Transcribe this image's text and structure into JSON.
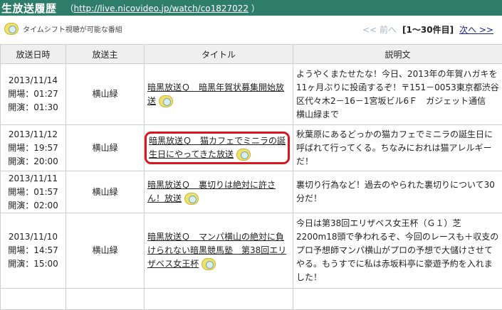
{
  "header": {
    "title": "生放送履歴",
    "open_paren": "（",
    "url": "http://live.nicovideo.jp/watch/co1827022",
    "close_paren": "）"
  },
  "toolbar": {
    "legend_icon": "timeshift-icon",
    "legend_text": "タイムシフト視聴が可能な番組",
    "prev_label": "<< 前へ",
    "range_label": "[1～30件目]",
    "next_label": "次へ >>"
  },
  "table": {
    "headers": [
      "放送日時",
      "放送主",
      "タイトル",
      "説明文"
    ],
    "rows": [
      {
        "date": "2013/11/14",
        "open": "開場：01:27",
        "start": "開演：01:30",
        "owner": "横山緑",
        "title": "暗黒放送Ｑ　暗黒年賀状募集開始放送",
        "desc": "ようやくまたせたな！今日、2013年の年賀ハガキを11ヶ月ぶりに投函するぞ！〒151－0053東京都渋谷区代々木2－16－1宮坂ビル6Ｆ　ガジェット通信　横山緑まで"
      },
      {
        "date": "2013/11/12",
        "open": "開場：19:57",
        "start": "開演：20:00",
        "owner": "横山緑",
        "title": "暗黒放送Ｑ　猫カフェでミニラの誕生日にやってきた放送",
        "desc": "秋葉原にあるどっかの猫カフェでミニラの誕生日に呼ばれて行ってくる。ちなみにおれは猫アレルギーだ！"
      },
      {
        "date": "2013/11/11",
        "open": "開場：01:57",
        "start": "開演：02:00",
        "owner": "横山緑",
        "title": "暗黒放送Ｑ　裏切りは絶対に許さん！放送",
        "desc": "裏切り行為など！過去のやられた裏切りについて30分だ！"
      },
      {
        "date": "2013/11/10",
        "open": "開場：14:57",
        "start": "開演：15:00",
        "owner": "横山緑",
        "title": "暗黒放送Ｑ　マンパ横山の絶対に負けられない暗黒競馬塾　第38回エリザベス女王杯",
        "desc": "今日は第38回エリザベス女王杯（Ｇ１）芝2200m18頭で争われるぞ、今回のレースも＋収支のプロ予想師マンパ横山がプロの予想で大儲けさせてやる。もうすでに私は赤坂料亭に豪遊予約を入れました！"
      }
    ]
  }
}
